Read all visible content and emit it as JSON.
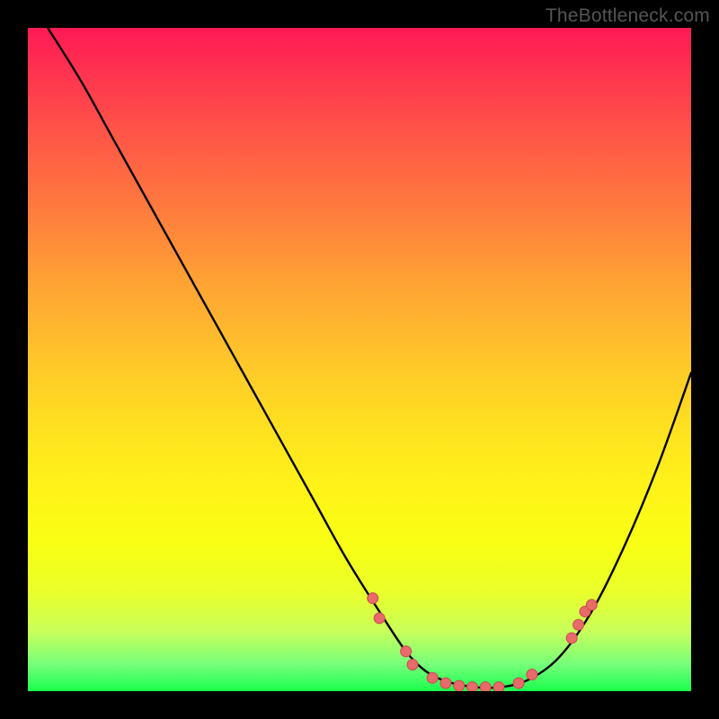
{
  "watermark": "TheBottleneck.com",
  "chart_data": {
    "type": "line",
    "title": "",
    "xlabel": "",
    "ylabel": "",
    "xlim": [
      0,
      100
    ],
    "ylim": [
      0,
      100
    ],
    "grid": false,
    "legend": false,
    "background_gradient": {
      "direction": "vertical",
      "stops": [
        {
          "position": 0,
          "color": "#ff1a55"
        },
        {
          "position": 50,
          "color": "#ffc62a"
        },
        {
          "position": 80,
          "color": "#f8ff14"
        },
        {
          "position": 100,
          "color": "#1aff4d"
        }
      ]
    },
    "series": [
      {
        "name": "curve",
        "stroke": "#000000",
        "stroke_width": 2,
        "x": [
          3,
          8,
          13,
          18,
          23,
          28,
          33,
          38,
          43,
          48,
          53,
          57,
          60,
          63,
          66,
          70,
          75,
          80,
          85,
          90,
          95,
          100
        ],
        "y": [
          100,
          92,
          83,
          74,
          65,
          56,
          47,
          38,
          29,
          20,
          12,
          6,
          3,
          1.5,
          0.8,
          0.5,
          1.5,
          5,
          12,
          22,
          34,
          48
        ]
      },
      {
        "name": "markers",
        "type": "scatter",
        "color": "#e86a6a",
        "radius": 6,
        "points": [
          {
            "x": 52,
            "y": 14
          },
          {
            "x": 53,
            "y": 11
          },
          {
            "x": 57,
            "y": 6
          },
          {
            "x": 58,
            "y": 4
          },
          {
            "x": 61,
            "y": 2
          },
          {
            "x": 63,
            "y": 1.2
          },
          {
            "x": 65,
            "y": 0.8
          },
          {
            "x": 67,
            "y": 0.6
          },
          {
            "x": 69,
            "y": 0.6
          },
          {
            "x": 71,
            "y": 0.6
          },
          {
            "x": 74,
            "y": 1.2
          },
          {
            "x": 76,
            "y": 2.5
          },
          {
            "x": 82,
            "y": 8
          },
          {
            "x": 83,
            "y": 10
          },
          {
            "x": 84,
            "y": 12
          },
          {
            "x": 85,
            "y": 13
          }
        ]
      }
    ]
  }
}
